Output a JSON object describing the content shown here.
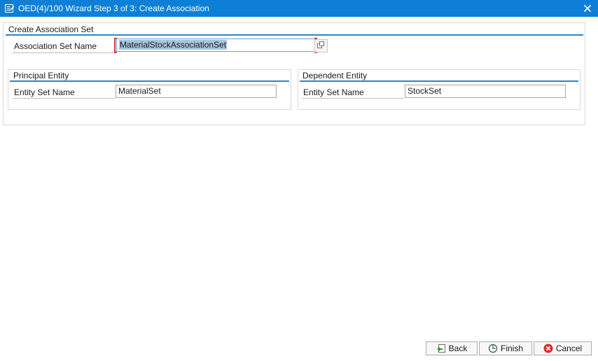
{
  "window": {
    "title": "OED(4)/100 Wizard Step 3 of 3: Create Association",
    "app_icon": "wizard-icon",
    "close_icon": "close-icon"
  },
  "association_set": {
    "group_title": "Create Association Set",
    "name_label": "Association Set Name",
    "name_value": "MaterialStockAssociationSet",
    "value_help_icon": "value-help-icon"
  },
  "principal": {
    "group_title": "Principal Entity",
    "entity_set_label": "Entity Set Name",
    "entity_set_value": "MaterialSet"
  },
  "dependent": {
    "group_title": "Dependent Entity",
    "entity_set_label": "Entity Set Name",
    "entity_set_value": "StockSet"
  },
  "buttons": {
    "back": {
      "label": "Back",
      "icon": "back-arrow-icon"
    },
    "finish": {
      "label": "Finish",
      "icon": "finish-icon"
    },
    "cancel": {
      "label": "Cancel",
      "icon": "cancel-icon"
    }
  },
  "colors": {
    "titlebar": "#0d7fd7",
    "group_line": "#2d86c7",
    "selection": "#a8c4de",
    "cancel_red": "#d9312b",
    "back_green": "#2e8b3d"
  }
}
